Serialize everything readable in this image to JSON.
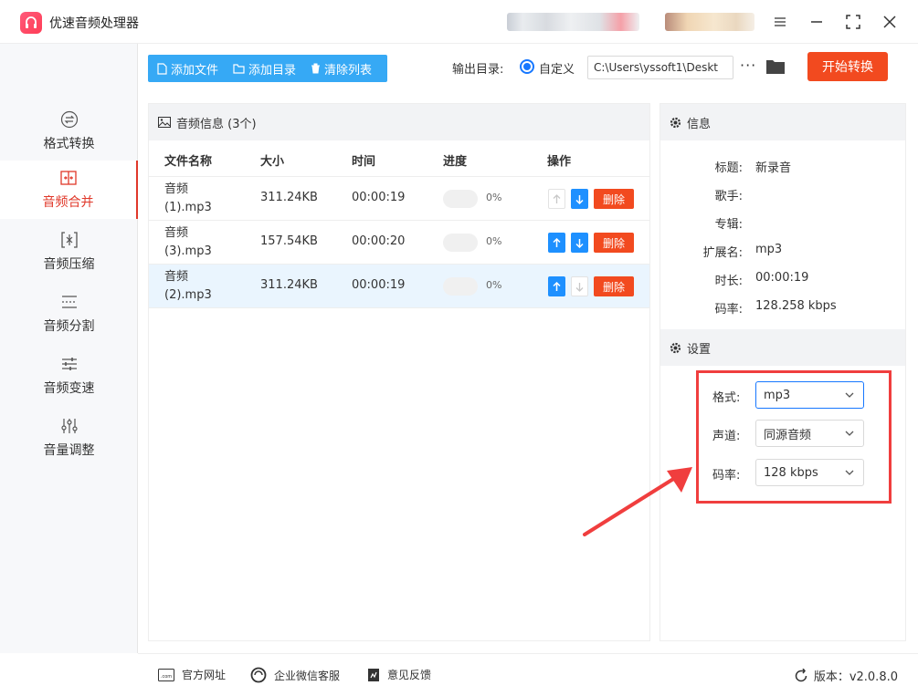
{
  "app": {
    "title": "优速音频处理器"
  },
  "sidebar": {
    "items": [
      {
        "label": "格式转换",
        "icon": "format-convert-icon"
      },
      {
        "label": "音频合并",
        "icon": "audio-merge-icon",
        "active": true
      },
      {
        "label": "音频压缩",
        "icon": "audio-compress-icon"
      },
      {
        "label": "音频分割",
        "icon": "audio-split-icon"
      },
      {
        "label": "音频变速",
        "icon": "audio-speed-icon"
      },
      {
        "label": "音量调整",
        "icon": "volume-adjust-icon"
      }
    ]
  },
  "toolbar": {
    "add_file": "添加文件",
    "add_dir": "添加目录",
    "clear_list": "清除列表",
    "output_label": "输出目录:",
    "output_option": "自定义",
    "output_path": "C:\\Users\\yssoft1\\Deskt",
    "more": "···",
    "start": "开始转换"
  },
  "file_panel": {
    "title": "音频信息 (3个)",
    "columns": [
      "文件名称",
      "大小",
      "时间",
      "进度",
      "操作"
    ],
    "rows": [
      {
        "name": "音频 (1).mp3",
        "size": "311.24KB",
        "time": "00:00:19",
        "progress": "0%",
        "up_enabled": false,
        "down_enabled": true,
        "delete": "删除"
      },
      {
        "name": "音频 (3).mp3",
        "size": "157.54KB",
        "time": "00:00:20",
        "progress": "0%",
        "up_enabled": true,
        "down_enabled": true,
        "delete": "删除"
      },
      {
        "name": "音频 (2).mp3",
        "size": "311.24KB",
        "time": "00:00:19",
        "progress": "0%",
        "up_enabled": true,
        "down_enabled": false,
        "delete": "删除",
        "selected": true
      }
    ]
  },
  "info": {
    "title": "信息",
    "fields": [
      {
        "label": "标题:",
        "value": "新录音"
      },
      {
        "label": "歌手:",
        "value": ""
      },
      {
        "label": "专辑:",
        "value": ""
      },
      {
        "label": "扩展名:",
        "value": "mp3"
      },
      {
        "label": "时长:",
        "value": "00:00:19"
      },
      {
        "label": "码率:",
        "value": "128.258 kbps"
      }
    ]
  },
  "settings": {
    "title": "设置",
    "format": {
      "label": "格式:",
      "value": "mp3"
    },
    "channel": {
      "label": "声道:",
      "value": "同源音频"
    },
    "bitrate": {
      "label": "码率:",
      "value": "128 kbps"
    }
  },
  "footer": {
    "website": "官方网址",
    "wechat": "企业微信客服",
    "feedback": "意见反馈",
    "version": "版本：v2.0.8.0"
  },
  "colors": {
    "accent": "#f24a1f",
    "primary": "#36a9f5",
    "blue": "#1e90ff",
    "annotation": "#f03e3e"
  }
}
